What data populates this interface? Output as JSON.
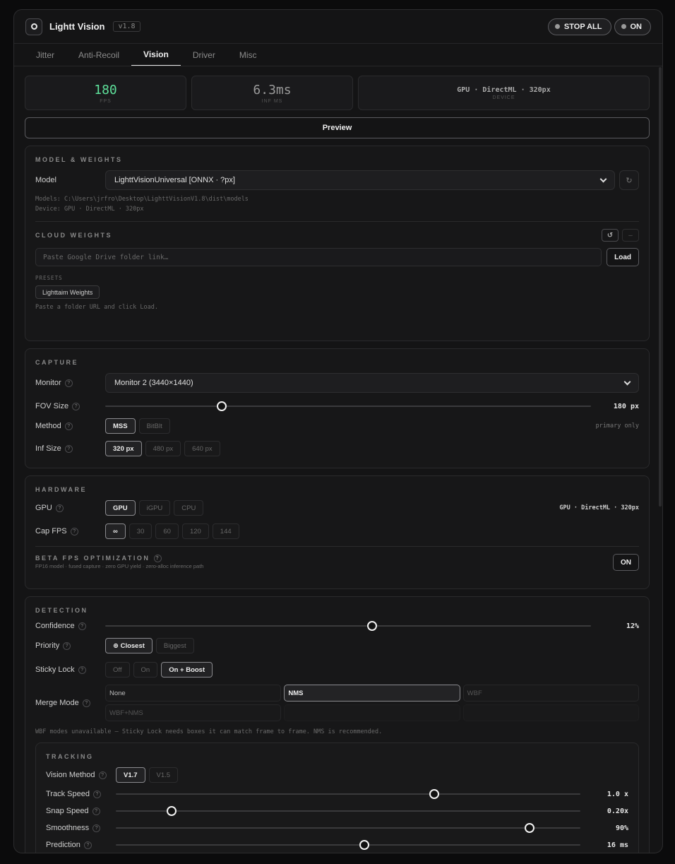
{
  "app": {
    "title": "Lightt Vision",
    "version": "v1.8"
  },
  "header": {
    "stop_all": "STOP ALL",
    "toggle": "ON"
  },
  "tabs": [
    {
      "label": "Jitter"
    },
    {
      "label": "Anti-Recoil"
    },
    {
      "label": "Vision"
    },
    {
      "label": "Driver"
    },
    {
      "label": "Misc"
    }
  ],
  "stats": {
    "fps": {
      "value": "180",
      "label": "FPS"
    },
    "inf": {
      "value": "6.3ms",
      "label": "INF MS"
    },
    "device": {
      "value": "GPU · DirectML · 320px",
      "label": "DEVICE"
    }
  },
  "preview_label": "Preview",
  "model": {
    "title": "MODEL & WEIGHTS",
    "label": "Model",
    "selected": "LighttVisionUniversal [ONNX · ?px]",
    "refresh_icon": "↻",
    "models_path": "Models: C:\\Users\\jrfro\\Desktop\\LighttVisionV1.8\\dist\\models",
    "device_line": "Device: GPU · DirectML · 320px",
    "cloud_title": "CLOUD WEIGHTS",
    "cloud_reload": "↺",
    "cloud_minus": "–",
    "link_placeholder": "Paste Google Drive folder link…",
    "load": "Load",
    "presets_label": "PRESETS",
    "preset": "Lighttaim Weights",
    "hint": "Paste a folder URL and click Load."
  },
  "capture": {
    "title": "CAPTURE",
    "monitor_label": "Monitor",
    "monitor_value": "Monitor 2 (3440×1440)",
    "fov_label": "FOV Size",
    "fov_value": "180 px",
    "fov_fraction": 0.24,
    "method_label": "Method",
    "methods": [
      "MSS",
      "BitBlt"
    ],
    "method_note": "primary only",
    "inf_label": "Inf Size",
    "inf_sizes": [
      "320 px",
      "480 px",
      "640 px"
    ]
  },
  "hardware": {
    "title": "HARDWARE",
    "gpu_label": "GPU",
    "gpu_options": [
      "GPU",
      "iGPU",
      "CPU"
    ],
    "gpu_note": "GPU · DirectML · 320px",
    "cap_label": "Cap FPS",
    "cap_options": [
      "∞",
      "30",
      "60",
      "120",
      "144"
    ],
    "beta_title": "BETA FPS OPTIMIZATION",
    "beta_desc": "FP16 model · fused capture · zero GPU yield · zero-alloc inference path",
    "beta_toggle": "ON"
  },
  "detection": {
    "title": "DETECTION",
    "confidence_label": "Confidence",
    "confidence_value": "12%",
    "confidence_fraction": 0.55,
    "priority_label": "Priority",
    "priority_options": [
      "⊕ Closest",
      "Biggest"
    ],
    "sticky_label": "Sticky Lock",
    "sticky_options": [
      "Off",
      "On",
      "On + Boost"
    ],
    "merge_label": "Merge Mode",
    "merge_options": [
      "None",
      "NMS",
      "WBF",
      "WBF+NMS"
    ],
    "merge_note": "WBF modes unavailable — Sticky Lock needs boxes it can match frame to frame. NMS is recommended."
  },
  "tracking": {
    "title": "TRACKING",
    "method_label": "Vision Method",
    "method_options": [
      "V1.7",
      "V1.5"
    ],
    "track_label": "Track Speed",
    "track_value": "1.0 x",
    "track_fraction": 0.685,
    "snap_label": "Snap Speed",
    "snap_value": "0.20x",
    "snap_fraction": 0.12,
    "smooth_label": "Smoothness",
    "smooth_value": "90%",
    "smooth_fraction": 0.89,
    "pred_label": "Prediction",
    "pred_value": "16 ms",
    "pred_fraction": 0.535
  }
}
